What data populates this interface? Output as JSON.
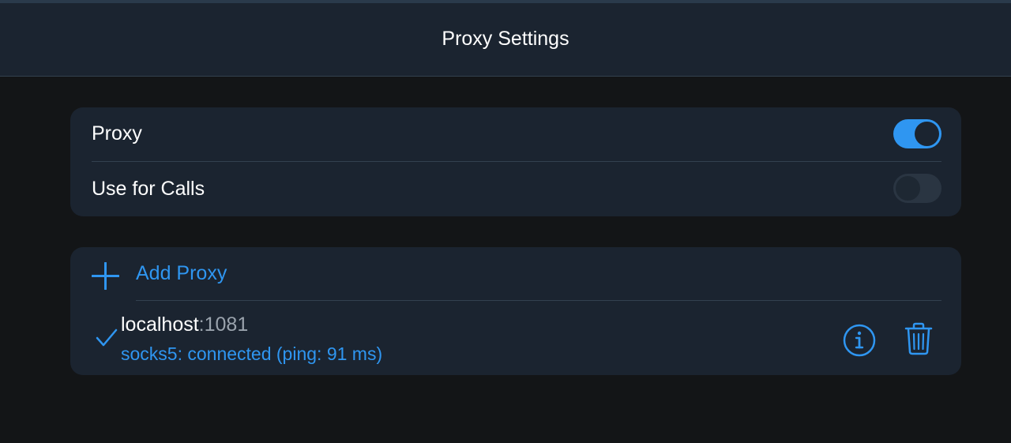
{
  "header": {
    "title": "Proxy Settings"
  },
  "settings": {
    "proxy": {
      "label": "Proxy",
      "enabled": true
    },
    "use_for_calls": {
      "label": "Use for Calls",
      "enabled": false
    }
  },
  "proxy_list": {
    "add_label": "Add Proxy",
    "items": [
      {
        "host": "localhost",
        "port": ":1081",
        "status": "socks5: connected (ping: 91 ms)",
        "selected": true
      }
    ]
  },
  "icons": {
    "add": "plus-icon",
    "selected": "checkmark-icon",
    "info": "info-icon",
    "delete": "trash-icon"
  },
  "colors": {
    "accent": "#2f96f1",
    "background": "#131517",
    "card": "#1b2430",
    "text": "#ffffff",
    "secondary_text": "#9aa3ad"
  }
}
